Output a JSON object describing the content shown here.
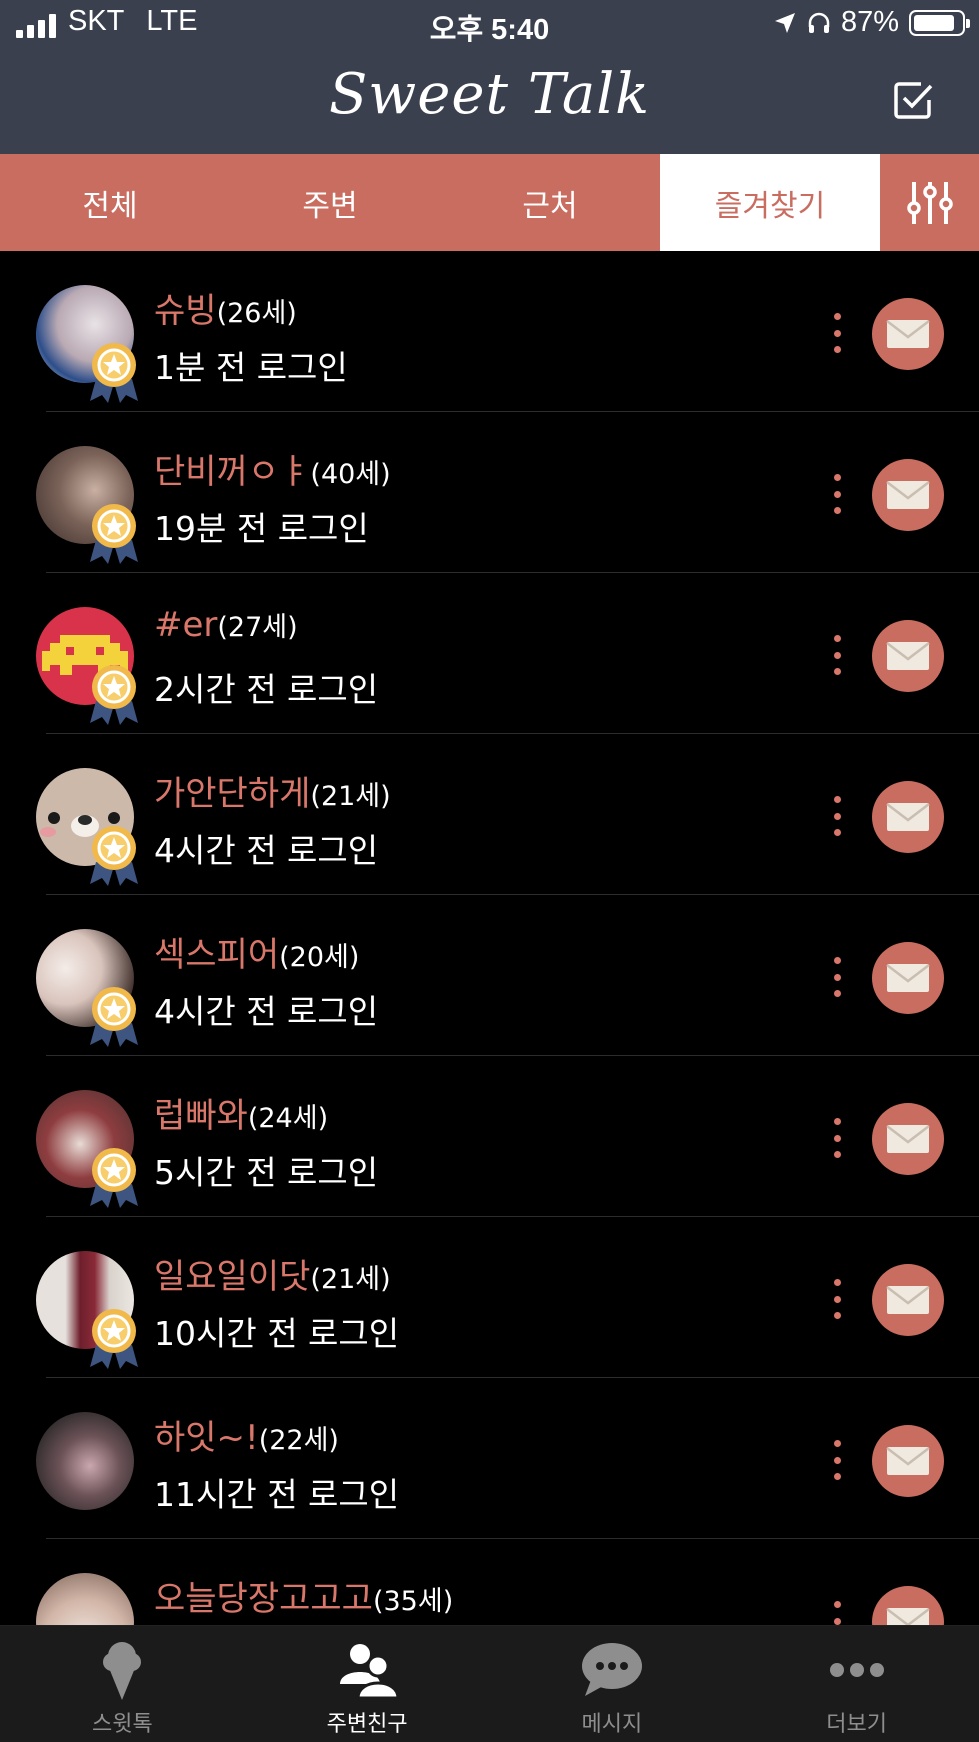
{
  "status_bar": {
    "carrier": "SKT",
    "network": "LTE",
    "time": "오후 5:40",
    "battery": "87%",
    "battery_level": 0.87
  },
  "header": {
    "title": "Sweet Talk"
  },
  "tabs": [
    {
      "label": "전체",
      "active": false
    },
    {
      "label": "주변",
      "active": false
    },
    {
      "label": "근처",
      "active": false
    },
    {
      "label": "즐겨찾기",
      "active": true
    }
  ],
  "users": [
    {
      "name": "슈빙",
      "age": "(26세)",
      "login": "1분 전 로그인"
    },
    {
      "name": "단비꺼ㅇㅑ",
      "age": "(40세)",
      "login": "19분 전 로그인"
    },
    {
      "name": "#er",
      "age": "(27세)",
      "login": "2시간 전 로그인"
    },
    {
      "name": "가안단하게",
      "age": "(21세)",
      "login": "4시간 전 로그인"
    },
    {
      "name": "섹스피어",
      "age": "(20세)",
      "login": "4시간 전 로그인"
    },
    {
      "name": "럽빠와",
      "age": "(24세)",
      "login": "5시간 전 로그인"
    },
    {
      "name": "일요일이닷",
      "age": "(21세)",
      "login": "10시간 전 로그인"
    },
    {
      "name": "하잇~!",
      "age": "(22세)",
      "login": "11시간 전 로그인"
    },
    {
      "name": "오늘당장고고고",
      "age": "(35세)",
      "login": ""
    }
  ],
  "bottom_nav": [
    {
      "label": "스윗톡",
      "icon": "ice-cream-icon",
      "active": false
    },
    {
      "label": "주변친구",
      "icon": "friends-icon",
      "active": true
    },
    {
      "label": "메시지",
      "icon": "chat-bubble-icon",
      "active": false
    },
    {
      "label": "더보기",
      "icon": "more-dots-icon",
      "active": false
    }
  ],
  "colors": {
    "header_bg": "#3a404d",
    "accent": "#c96d60",
    "name_text": "#d9776a",
    "background": "#000000",
    "tabbar_bg": "#1b1b1b"
  }
}
